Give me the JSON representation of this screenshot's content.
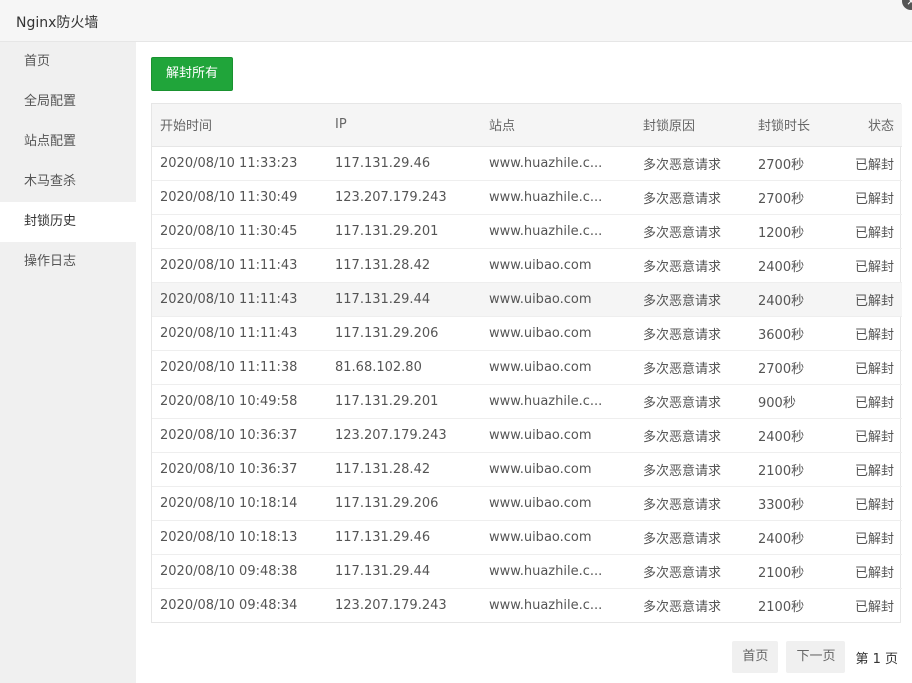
{
  "window": {
    "title": "Nginx防火墙",
    "close_glyph": "×"
  },
  "sidebar": {
    "items": [
      {
        "label": "首页",
        "active": false
      },
      {
        "label": "全局配置",
        "active": false
      },
      {
        "label": "站点配置",
        "active": false
      },
      {
        "label": "木马查杀",
        "active": false
      },
      {
        "label": "封锁历史",
        "active": true
      },
      {
        "label": "操作日志",
        "active": false
      }
    ]
  },
  "toolbar": {
    "unblock_all_label": "解封所有",
    "accent": "#20a53a"
  },
  "table": {
    "headers": [
      "开始时间",
      "IP",
      "站点",
      "封锁原因",
      "封锁时长",
      "状态"
    ],
    "rows": [
      [
        "2020/08/10 11:33:23",
        "117.131.29.46",
        "www.huazhile.c...",
        "多次恶意请求",
        "2700秒",
        "已解封"
      ],
      [
        "2020/08/10 11:30:49",
        "123.207.179.243",
        "www.huazhile.c...",
        "多次恶意请求",
        "2700秒",
        "已解封"
      ],
      [
        "2020/08/10 11:30:45",
        "117.131.29.201",
        "www.huazhile.c...",
        "多次恶意请求",
        "1200秒",
        "已解封"
      ],
      [
        "2020/08/10 11:11:43",
        "117.131.28.42",
        "www.uibao.com",
        "多次恶意请求",
        "2400秒",
        "已解封"
      ],
      [
        "2020/08/10 11:11:43",
        "117.131.29.44",
        "www.uibao.com",
        "多次恶意请求",
        "2400秒",
        "已解封"
      ],
      [
        "2020/08/10 11:11:43",
        "117.131.29.206",
        "www.uibao.com",
        "多次恶意请求",
        "3600秒",
        "已解封"
      ],
      [
        "2020/08/10 11:11:38",
        "81.68.102.80",
        "www.uibao.com",
        "多次恶意请求",
        "2700秒",
        "已解封"
      ],
      [
        "2020/08/10 10:49:58",
        "117.131.29.201",
        "www.huazhile.c...",
        "多次恶意请求",
        "900秒",
        "已解封"
      ],
      [
        "2020/08/10 10:36:37",
        "123.207.179.243",
        "www.uibao.com",
        "多次恶意请求",
        "2400秒",
        "已解封"
      ],
      [
        "2020/08/10 10:36:37",
        "117.131.28.42",
        "www.uibao.com",
        "多次恶意请求",
        "2100秒",
        "已解封"
      ],
      [
        "2020/08/10 10:18:14",
        "117.131.29.206",
        "www.uibao.com",
        "多次恶意请求",
        "3300秒",
        "已解封"
      ],
      [
        "2020/08/10 10:18:13",
        "117.131.29.46",
        "www.uibao.com",
        "多次恶意请求",
        "2400秒",
        "已解封"
      ],
      [
        "2020/08/10 09:48:38",
        "117.131.29.44",
        "www.huazhile.c...",
        "多次恶意请求",
        "2100秒",
        "已解封"
      ],
      [
        "2020/08/10 09:48:34",
        "123.207.179.243",
        "www.huazhile.c...",
        "多次恶意请求",
        "2100秒",
        "已解封"
      ]
    ],
    "highlighted_row": 4
  },
  "pagination": {
    "first_label": "首页",
    "next_label": "下一页",
    "current_label": "第 1 页"
  }
}
